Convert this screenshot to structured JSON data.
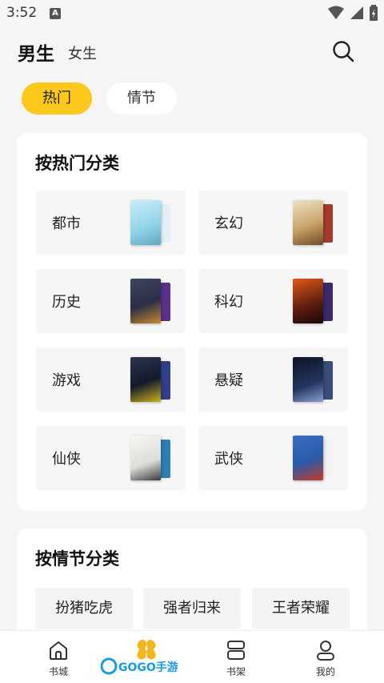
{
  "status_bar": {
    "time": "3:52",
    "notif_letter": "A"
  },
  "header": {
    "tab_male": "男生",
    "tab_female": "女生"
  },
  "filters": {
    "hot": "热门",
    "plot": "情节"
  },
  "hot_section": {
    "title": "按热门分类",
    "categories": [
      {
        "label": "都市",
        "cover_colors": [
          "#8fd3e8",
          "#e2f1f6"
        ]
      },
      {
        "label": "玄幻",
        "cover_colors": [
          "#c9a46a",
          "#a43a2c"
        ]
      },
      {
        "label": "历史",
        "cover_colors": [
          "#2a2f45",
          "#5b2f8c"
        ]
      },
      {
        "label": "科幻",
        "cover_colors": [
          "#5a1b0f",
          "#e05a18"
        ]
      },
      {
        "label": "游戏",
        "cover_colors": [
          "#141a2c",
          "#2f3f8a"
        ]
      },
      {
        "label": "悬疑",
        "cover_colors": [
          "#0c1326",
          "#3a4c7a"
        ]
      },
      {
        "label": "仙侠",
        "cover_colors": [
          "#f0f0ee",
          "#2b7fb3"
        ]
      },
      {
        "label": "武侠",
        "cover_colors": [
          "#2a5aa8",
          "#f2f2f2"
        ]
      }
    ]
  },
  "plot_section": {
    "title": "按情节分类",
    "tags": [
      "扮猪吃虎",
      "强者归来",
      "王者荣耀"
    ]
  },
  "bottom_nav": {
    "items": [
      {
        "label": "书城",
        "icon": "home-icon"
      },
      {
        "label": "",
        "icon": "discover-icon"
      },
      {
        "label": "书架",
        "icon": "bookshelf-icon"
      },
      {
        "label": "我的",
        "icon": "profile-icon"
      }
    ]
  },
  "watermark": {
    "text": "GOGO手游网"
  },
  "colors": {
    "accent": "#fcc81c",
    "card_bg": "#ffffff",
    "page_bg": "#f5f5f5"
  }
}
